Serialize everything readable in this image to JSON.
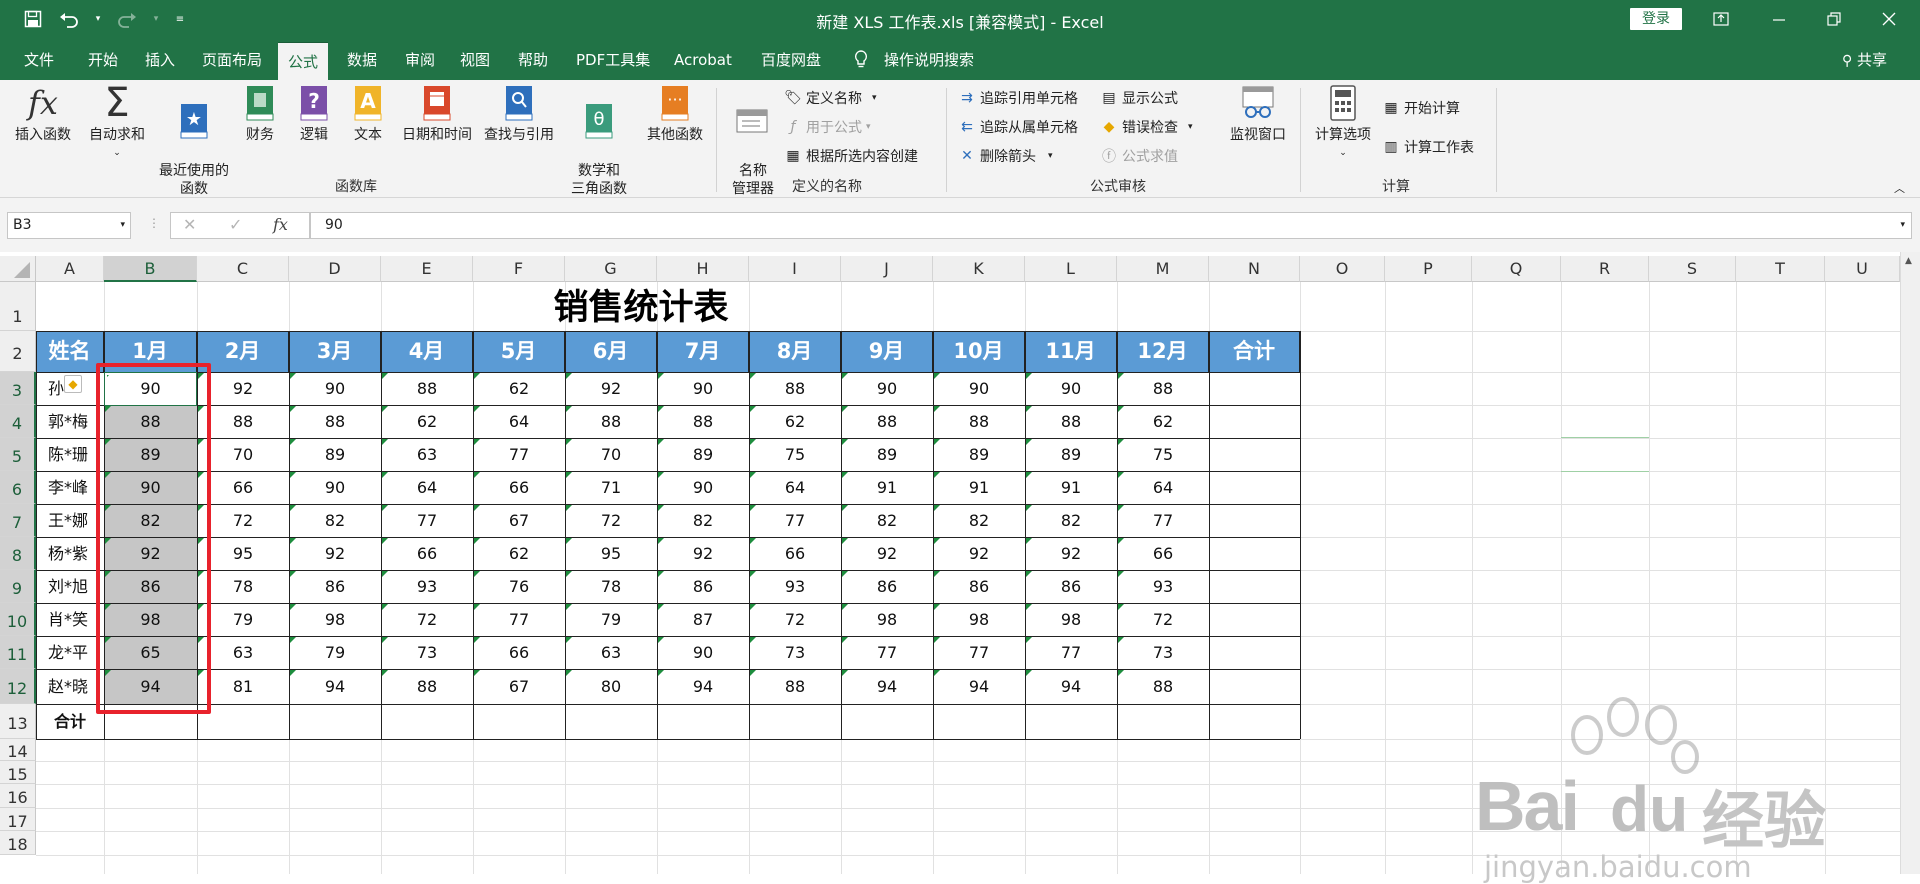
{
  "window": {
    "title": "新建 XLS 工作表.xls  [兼容模式]  -  Excel",
    "login_label": "登录",
    "accent": "#217346"
  },
  "tabs": [
    "文件",
    "开始",
    "插入",
    "页面布局",
    "公式",
    "数据",
    "审阅",
    "视图",
    "帮助",
    "PDF工具集",
    "Acrobat",
    "百度网盘",
    "操作说明搜索"
  ],
  "active_tab": "公式",
  "share_label": "共享",
  "ribbon": {
    "function_library": {
      "buttons": [
        {
          "label": "插入函数",
          "icon": "fx-icon"
        },
        {
          "label": "自动求和",
          "icon": "sigma-icon"
        },
        {
          "label": "最近使用的\n函数",
          "icon": "star-book-icon"
        },
        {
          "label": "财务",
          "icon": "finance-book-icon"
        },
        {
          "label": "逻辑",
          "icon": "question-book-icon"
        },
        {
          "label": "文本",
          "icon": "text-book-icon"
        },
        {
          "label": "日期和时间",
          "icon": "calendar-book-icon"
        },
        {
          "label": "查找与引用",
          "icon": "search-book-icon"
        },
        {
          "label": "数学和\n三角函数",
          "icon": "theta-book-icon"
        },
        {
          "label": "其他函数",
          "icon": "more-book-icon"
        }
      ],
      "group_label": "函数库"
    },
    "defined_names": {
      "name_manager": "名称\n管理器",
      "define_name": "定义名称",
      "use_in_formula": "用于公式",
      "create_from_selection": "根据所选内容创建",
      "group_label": "定义的名称"
    },
    "formula_auditing": {
      "trace_precedents": "追踪引用单元格",
      "trace_dependents": "追踪从属单元格",
      "remove_arrows": "删除箭头",
      "show_formulas": "显示公式",
      "error_checking": "错误检查",
      "evaluate_formula": "公式求值",
      "watch_window": "监视窗口",
      "group_label": "公式审核"
    },
    "calculation": {
      "calc_options": "计算选项",
      "calc_now": "开始计算",
      "calc_sheet": "计算工作表",
      "group_label": "计算"
    }
  },
  "formula_bar": {
    "name_box": "B3",
    "fx_label": "fx",
    "value": "90"
  },
  "columns": [
    "A",
    "B",
    "C",
    "D",
    "E",
    "F",
    "G",
    "H",
    "I",
    "J",
    "K",
    "L",
    "M",
    "N",
    "O",
    "P",
    "Q",
    "R",
    "S",
    "T",
    "U"
  ],
  "rows": [
    "1",
    "2",
    "3",
    "4",
    "5",
    "6",
    "7",
    "8",
    "9",
    "10",
    "11",
    "12",
    "13",
    "14",
    "15",
    "16",
    "17",
    "18"
  ],
  "selected_column": "B",
  "selected_rows": [
    "3",
    "4",
    "5",
    "6",
    "7",
    "8",
    "9",
    "10",
    "11",
    "12"
  ],
  "sheet": {
    "title": "销售统计表",
    "headers": [
      "姓名",
      "1月",
      "2月",
      "3月",
      "4月",
      "5月",
      "6月",
      "7月",
      "8月",
      "9月",
      "10月",
      "11月",
      "12月",
      "合计"
    ],
    "names": [
      "孙",
      "郭*梅",
      "陈*珊",
      "李*峰",
      "王*娜",
      "杨*紫",
      "刘*旭",
      "肖*笑",
      "龙*平",
      "赵*晓"
    ],
    "values": [
      [
        90,
        92,
        90,
        88,
        62,
        92,
        90,
        88,
        90,
        90,
        90,
        88
      ],
      [
        88,
        88,
        88,
        62,
        64,
        88,
        88,
        62,
        88,
        88,
        88,
        62
      ],
      [
        89,
        70,
        89,
        63,
        77,
        70,
        89,
        75,
        89,
        89,
        89,
        75
      ],
      [
        90,
        66,
        90,
        64,
        66,
        71,
        90,
        64,
        91,
        91,
        91,
        64
      ],
      [
        82,
        72,
        82,
        77,
        67,
        72,
        82,
        77,
        82,
        82,
        82,
        77
      ],
      [
        92,
        95,
        92,
        66,
        62,
        95,
        92,
        66,
        92,
        92,
        92,
        66
      ],
      [
        86,
        78,
        86,
        93,
        76,
        78,
        86,
        93,
        86,
        86,
        86,
        93
      ],
      [
        98,
        79,
        98,
        72,
        77,
        79,
        87,
        72,
        98,
        98,
        98,
        72
      ],
      [
        65,
        63,
        79,
        73,
        66,
        63,
        90,
        73,
        77,
        77,
        77,
        73
      ],
      [
        94,
        81,
        94,
        88,
        67,
        80,
        94,
        88,
        94,
        94,
        94,
        88
      ]
    ],
    "total_label": "合计",
    "header_color": "#5b9bd5",
    "highlight_color": "#e8222c"
  },
  "watermark": {
    "brand": "Bai",
    "brand_tail": "du",
    "cn": "经验",
    "url": "jingyan.baidu.com"
  }
}
